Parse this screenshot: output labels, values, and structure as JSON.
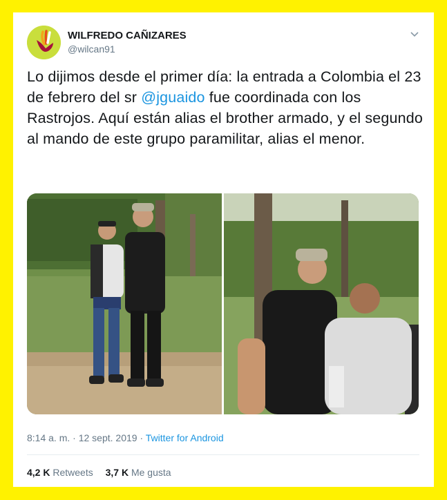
{
  "tweet": {
    "author_name": "WILFREDO CAÑIZARES",
    "author_handle": "@wilcan91",
    "text_before_mention": "Lo dijimos desde el primer día: la entrada a Colombia el 23 de febrero del sr ",
    "mention": "@jguaido",
    "text_after_mention": " fue coordinada con los Rastrojos. Aquí están alias el brother armado, y el segundo al mando de este grupo paramilitar, alias el menor.",
    "time": "8:14 a. m.",
    "separator": " · ",
    "date": "12 sept. 2019",
    "source": "Twitter for Android",
    "retweets_count": "4,2 K",
    "retweets_label": "Retweets",
    "likes_count": "3,7 K",
    "likes_label": "Me gusta"
  },
  "icons": {
    "avatar": "logo-avatar",
    "menu": "chevron-down-icon"
  },
  "colors": {
    "background": "#fff200",
    "link": "#1b95e0",
    "text": "#14171a",
    "muted": "#657786"
  }
}
